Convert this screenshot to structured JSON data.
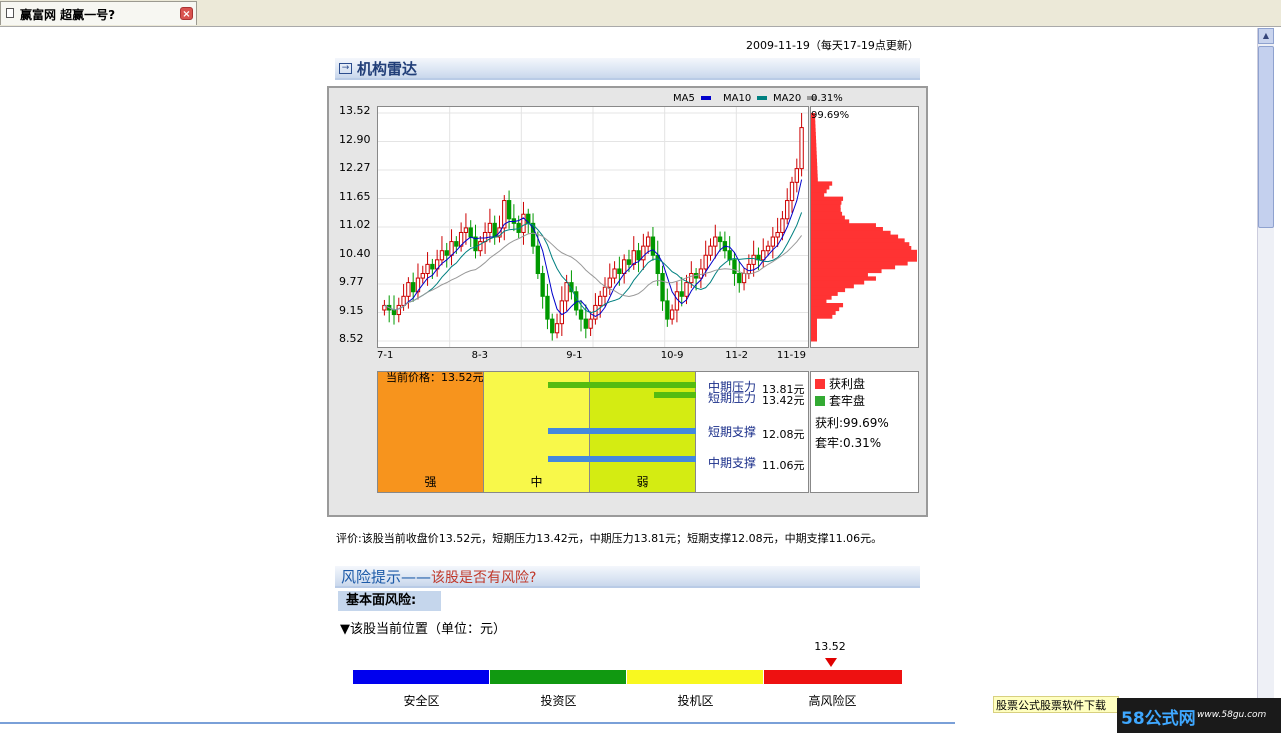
{
  "tab": {
    "title": "赢富网  超赢一号?"
  },
  "date_note": "2009-11-19（每天17-19点更新）",
  "section1": {
    "title": "机构雷达"
  },
  "legend": {
    "ma5": "MA5",
    "ma10": "MA10",
    "ma20": "MA20"
  },
  "colors": {
    "ma5": "#0000cc",
    "ma10": "#008080",
    "ma20": "#999999",
    "up": "#cc0000",
    "down": "#009900",
    "profit": "#ff3333",
    "trapped": "#33aa33",
    "orange": "#f7941d",
    "yellow": "#f8f84a",
    "lime": "#d4ec12",
    "levelGreen": "#55bb11",
    "levelBlue": "#4488dd"
  },
  "profile": {
    "trapped_pct": "0.31%",
    "profit_pct": "99.69%"
  },
  "chart_data": {
    "type": "candlestick",
    "ylim": [
      8.52,
      13.52
    ],
    "yticks": [
      "13.52",
      "12.90",
      "12.27",
      "11.65",
      "11.02",
      "10.40",
      "9.77",
      "9.15",
      "8.52"
    ],
    "xticks": [
      "7-1",
      "8-3",
      "9-1",
      "10-9",
      "11-2",
      "11-19"
    ],
    "closes": [
      9.3,
      9.2,
      9.1,
      9.3,
      9.5,
      9.8,
      9.6,
      9.9,
      10.0,
      10.2,
      10.1,
      10.3,
      10.5,
      10.4,
      10.7,
      10.6,
      10.9,
      11.0,
      10.8,
      10.5,
      10.7,
      10.9,
      11.1,
      10.8,
      11.0,
      11.6,
      11.2,
      11.1,
      10.9,
      11.3,
      11.1,
      10.6,
      10.0,
      9.5,
      9.0,
      8.7,
      8.9,
      9.4,
      9.8,
      9.6,
      9.2,
      9.0,
      8.8,
      9.0,
      9.3,
      9.5,
      9.7,
      9.9,
      10.1,
      10.0,
      10.3,
      10.2,
      10.5,
      10.3,
      10.6,
      10.8,
      10.4,
      10.0,
      9.4,
      9.0,
      9.2,
      9.6,
      9.5,
      9.8,
      10.0,
      9.9,
      10.1,
      10.4,
      10.6,
      10.8,
      10.7,
      10.5,
      10.3,
      10.0,
      9.8,
      10.0,
      10.2,
      10.4,
      10.3,
      10.5,
      10.6,
      10.8,
      10.9,
      11.2,
      11.6,
      12.0,
      12.3,
      13.2
    ]
  },
  "zones": {
    "strong": "强",
    "medium": "中",
    "weak": "弱"
  },
  "current_price_label": "当前价格：13.52元",
  "levels": [
    {
      "name": "中期压力",
      "value": "13.81元"
    },
    {
      "name": "短期压力",
      "value": "13.42元"
    },
    {
      "name": "短期支撑",
      "value": "12.08元"
    },
    {
      "name": "中期支撑",
      "value": "11.06元"
    }
  ],
  "side": {
    "profit_label": "获利盘",
    "trapped_label": "套牢盘",
    "profit_text": "获利:99.69%",
    "trapped_text": "套牢:0.31%"
  },
  "evaluation": "评价:该股当前收盘价13.52元，短期压力13.42元，中期压力13.81元；短期支撑12.08元，中期支撑11.06元。",
  "section2": {
    "title": "风险提示——",
    "subtitle": "该股是否有风险?"
  },
  "fundamental_risk": "基本面风险:",
  "current_position": "▼该股当前位置（单位：元）",
  "risk_marker": "13.52",
  "risk_bands": [
    {
      "label": "安全区",
      "color": "#0000ee"
    },
    {
      "label": "投资区",
      "color": "#119911"
    },
    {
      "label": "投机区",
      "color": "#f8f820"
    },
    {
      "label": "高风险区",
      "color": "#ee1111"
    }
  ],
  "ad_text": "股票公式股票软件下载",
  "logo": {
    "main": "58公式网",
    "url": "www.58gu.com"
  }
}
